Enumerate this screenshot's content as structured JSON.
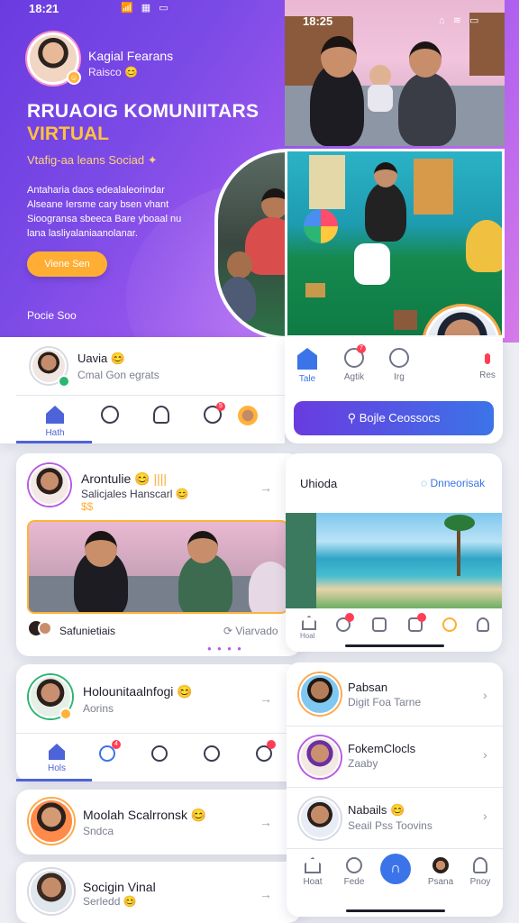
{
  "status": {
    "time_left": "18:21",
    "time_right": "18:25"
  },
  "hero": {
    "profile_name": "Kagial Fearans",
    "profile_sub": "Raisco",
    "title_line1": "RRUAOIG KOMUNIITARS",
    "title_line2": "VIRTUAL",
    "tagline": "Vtafig-aa leans Sociad",
    "description": "Antaharia daos edealaleorindar Alseane Iersme cary bsen vhant Sioogransa sbeeca Bare yboaal nu lana lasliyalaniaanolanar.",
    "cta_label": "Viene Sen",
    "footer_label": "Pocie Soo"
  },
  "top_nav": {
    "user_name": "Uavia",
    "user_sub": "Cmal Gon egrats",
    "tabs": [
      {
        "label": "Hath",
        "icon": "home-icon"
      },
      {
        "label": "",
        "icon": "search-icon"
      },
      {
        "label": "",
        "icon": "profile-icon"
      },
      {
        "label": "",
        "icon": "compass-icon"
      },
      {
        "label": "",
        "icon": "avatar-icon"
      }
    ],
    "badge_count": "5"
  },
  "right_nav": {
    "tabs": [
      {
        "label": "Tale",
        "icon": "home-icon"
      },
      {
        "label": "Agtik",
        "icon": "heart-icon"
      },
      {
        "label": "Irg",
        "icon": "chat-icon"
      },
      {
        "label": "Res",
        "icon": "bell-icon"
      }
    ],
    "button_label": "Bojle Ceossocs",
    "badge_count": "7"
  },
  "feed_post": {
    "author": "Arontulie",
    "subtitle": "Salicjales Hanscarl",
    "footer_label": "Safunietiais",
    "footer_right": "Viarvado"
  },
  "beach_card": {
    "title": "Uhioda",
    "action_label": "Dnneorisak",
    "tabs": [
      "Hoal",
      "",
      "",
      "",
      "",
      ""
    ]
  },
  "profile_list": {
    "name": "Holounitaalnfogi",
    "sub": "Aorins",
    "nav_label": "Hols",
    "badge_count": "4"
  },
  "contacts_left": [
    {
      "name": "Moolah Scalrronsk",
      "sub": "Sndca"
    },
    {
      "name": "Socigin Vinal",
      "sub": "Serledd"
    }
  ],
  "contacts_right": [
    {
      "name": "Pabsan",
      "sub": "Digit Foa Tarne"
    },
    {
      "name": "FokemClocls",
      "sub": "Zaaby"
    },
    {
      "name": "Nabails",
      "sub": "Seail Pss Toovins"
    }
  ],
  "bottom_nav": {
    "labels": [
      "Hoat",
      "Fede",
      "",
      "Psana",
      "Pnoy"
    ]
  },
  "colors": {
    "accent": "#6a3be0",
    "gold": "#ffae33",
    "blue": "#4c63d9",
    "teal": "#1aa6a0"
  }
}
